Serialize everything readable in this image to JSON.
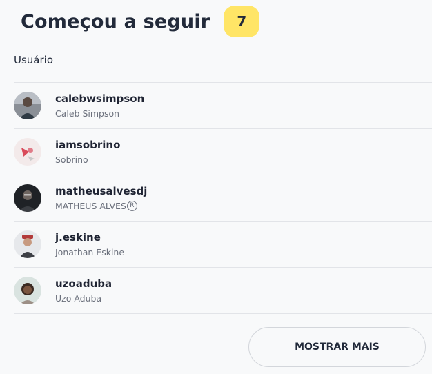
{
  "header": {
    "title": "Começou a seguir",
    "count": "7"
  },
  "table": {
    "column_user": "Usuário"
  },
  "users": [
    {
      "username": "calebwsimpson",
      "name": "Caleb Simpson"
    },
    {
      "username": "iamsobrino",
      "name": "Sobrino"
    },
    {
      "username": "matheusalvesdj",
      "name": "MATHEUS ALVES",
      "mark": "R"
    },
    {
      "username": "j.eskine",
      "name": "Jonathan Eskine"
    },
    {
      "username": "uzoaduba",
      "name": "Uzo Aduba"
    }
  ],
  "actions": {
    "show_more": "MOSTRAR MAIS"
  },
  "colors": {
    "badge": "#ffe566",
    "background": "#f8f9fa",
    "text": "#222a3a",
    "muted": "#6b707c"
  }
}
